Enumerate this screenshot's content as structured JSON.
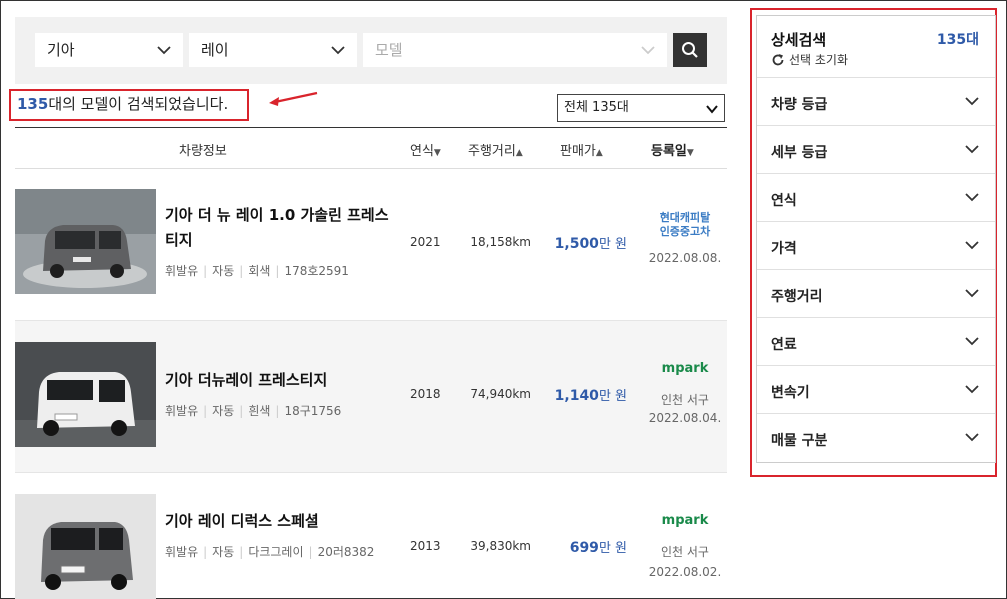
{
  "search": {
    "maker": "기아",
    "model_group": "레이",
    "model_placeholder": "모델"
  },
  "result": {
    "count": "135",
    "suffix": "대의 모델이 검색되었습니다.",
    "total_select": "전체 135대"
  },
  "table": {
    "headers": {
      "info": "차량정보",
      "year": "연식",
      "mileage": "주행거리",
      "price": "판매가",
      "registered": "등록일"
    },
    "rows": [
      {
        "title": "기아 더 뉴 레이 1.0 가솔린 프레스티지",
        "fuel": "휘발유",
        "transmission": "자동",
        "color": "회색",
        "plate": "178호2591",
        "year": "2021",
        "mileage": "18,158km",
        "price": "1,500",
        "price_unit": "만 원",
        "dealer_line1": "현대캐피탈",
        "dealer_line2": "인증중고차",
        "location": "",
        "date": "2022.08.08."
      },
      {
        "title": "기아 더뉴레이 프레스티지",
        "fuel": "휘발유",
        "transmission": "자동",
        "color": "흰색",
        "plate": "18구1756",
        "year": "2018",
        "mileage": "74,940km",
        "price": "1,140",
        "price_unit": "만 원",
        "dealer_logo": "mpark",
        "location": "인천 서구",
        "date": "2022.08.04."
      },
      {
        "title": "기아 레이 디럭스 스페셜",
        "fuel": "휘발유",
        "transmission": "자동",
        "color": "다크그레이",
        "plate": "20러8382",
        "year": "2013",
        "mileage": "39,830km",
        "price": "699",
        "price_unit": "만 원",
        "dealer_logo": "mpark",
        "location": "인천 서구",
        "date": "2022.08.02."
      }
    ]
  },
  "sidebar": {
    "title": "상세검색",
    "count": "135대",
    "reset": "선택 초기화",
    "items": [
      "차량 등급",
      "세부 등급",
      "연식",
      "가격",
      "주행거리",
      "연료",
      "변속기",
      "매물 구분"
    ]
  },
  "colors": {
    "accent_blue": "#2f5aa8",
    "highlight_red": "#d9242c",
    "mpark_green": "#1a8a4a"
  }
}
